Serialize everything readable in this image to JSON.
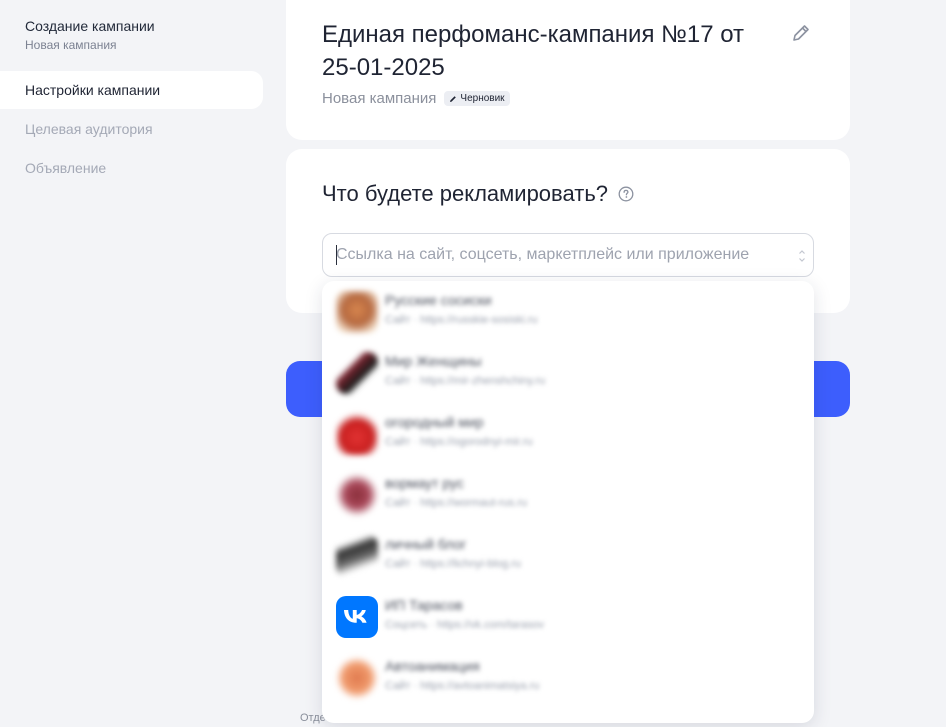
{
  "sidebar": {
    "title": "Создание кампании",
    "subtitle": "Новая кампания",
    "items": [
      {
        "label": "Настройки кампании",
        "active": true
      },
      {
        "label": "Целевая аудитория",
        "active": false
      },
      {
        "label": "Объявление",
        "active": false
      }
    ]
  },
  "campaign": {
    "title": "Единая перфоманс-кампания №17 от 25-01-2025",
    "status": "Новая кампания",
    "badge": "Черновик",
    "edit_icon": "pencil-icon"
  },
  "promo": {
    "question": "Что будете рекламировать?",
    "help_icon": "question-circle-icon",
    "input_value": "",
    "input_placeholder": "Ссылка на сайт, соцсеть, маркетплейс или приложение"
  },
  "suggestions": [
    {
      "name": "Русские сосиски",
      "meta": "Сайт · https://russkie-sosiski.ru",
      "icon": "food-icon",
      "color": "#b5683f",
      "blurred": true
    },
    {
      "name": "Мир Женщины",
      "meta": "Сайт · https://mir-zhenshchiny.ru",
      "icon": "knife-icon",
      "color": "#7a2530",
      "blurred": true
    },
    {
      "name": "огородный мир",
      "meta": "Сайт · https://ogorodnyi-mir.ru",
      "icon": "pepper-icon",
      "color": "#d42b2b",
      "blurred": true
    },
    {
      "name": "вормаут рус",
      "meta": "Сайт · https://wormaut-rus.ru",
      "icon": "figure-icon",
      "color": "#8a2f3a",
      "blurred": true
    },
    {
      "name": "личный блог",
      "meta": "Сайт · https://lichnyi-blog.ru",
      "icon": "logo-mark-icon",
      "color": "#333333",
      "blurred": true
    },
    {
      "name": "ИП Тарасов",
      "meta": "Соцсеть · https://vk.com/tarasov",
      "icon": "vk-icon",
      "color": "#0077ff",
      "blurred": true
    },
    {
      "name": "Автоанимация",
      "meta": "Сайт · https://avtoanimatsiya.ru",
      "icon": "orange-circle-icon",
      "color": "#e07a4f",
      "blurred": true
    }
  ],
  "footer": {
    "text": "Отде"
  },
  "colors": {
    "accent": "#3d5efd",
    "background": "#f3f4f7",
    "card": "#ffffff"
  }
}
